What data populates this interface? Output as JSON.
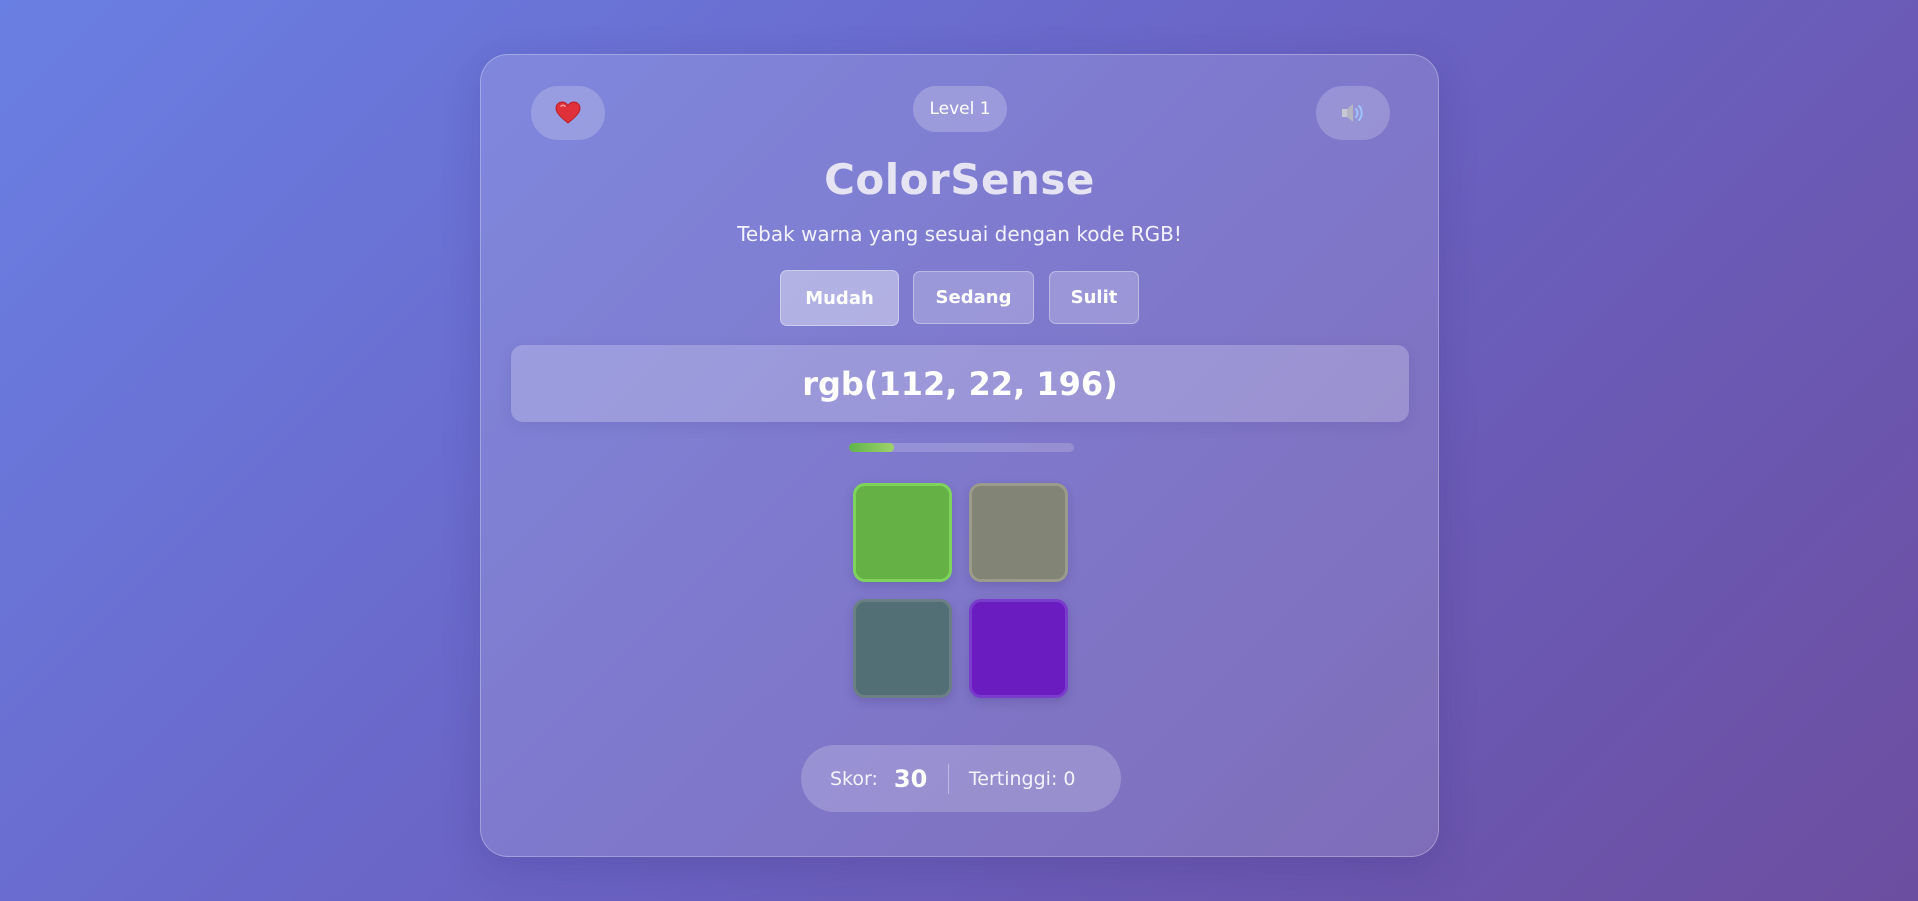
{
  "header": {
    "level": "Level 1",
    "lives_icon": "heart-icon",
    "sound_icon": "speaker-icon"
  },
  "title": "ColorSense",
  "subtitle": "Tebak warna yang sesuai dengan kode RGB!",
  "difficulty": {
    "options": [
      "Mudah",
      "Sedang",
      "Sulit"
    ],
    "selected": "Mudah"
  },
  "target_rgb": "rgb(112, 22, 196)",
  "progress_fraction": 0.2,
  "tiles": [
    {
      "color": "#65b146",
      "border": "#7ed35c"
    },
    {
      "color": "#828475",
      "border": "#9a9b8a"
    },
    {
      "color": "#526f76",
      "border": "#6a8085"
    },
    {
      "color": "#6a1cc1",
      "border": "#7a3ccc"
    }
  ],
  "score": {
    "label": "Skor:",
    "value": "30",
    "best": "Tertinggi: 0"
  }
}
